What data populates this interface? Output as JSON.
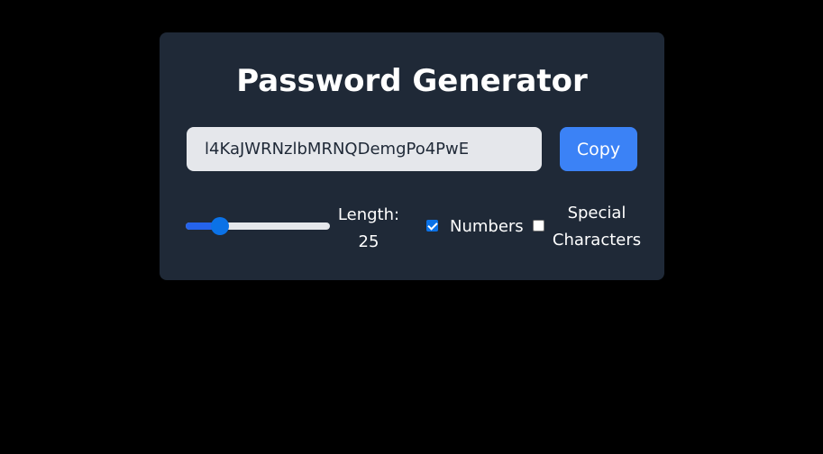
{
  "title": "Password Generator",
  "password": {
    "value": "l4KaJWRNzlbMRNQDemgPo4PwE"
  },
  "copy_button": {
    "label": "Copy"
  },
  "length": {
    "label": "Length:",
    "value": "25",
    "slider_fraction": 0.24
  },
  "options": {
    "numbers": {
      "label": "Numbers",
      "checked": true
    },
    "special": {
      "label_line1": "Special",
      "label_line2": "Characters",
      "checked": false
    }
  },
  "colors": {
    "background": "#000000",
    "card": "#1f2937",
    "accent": "#3b82f6",
    "input_bg": "#e5e7eb"
  }
}
